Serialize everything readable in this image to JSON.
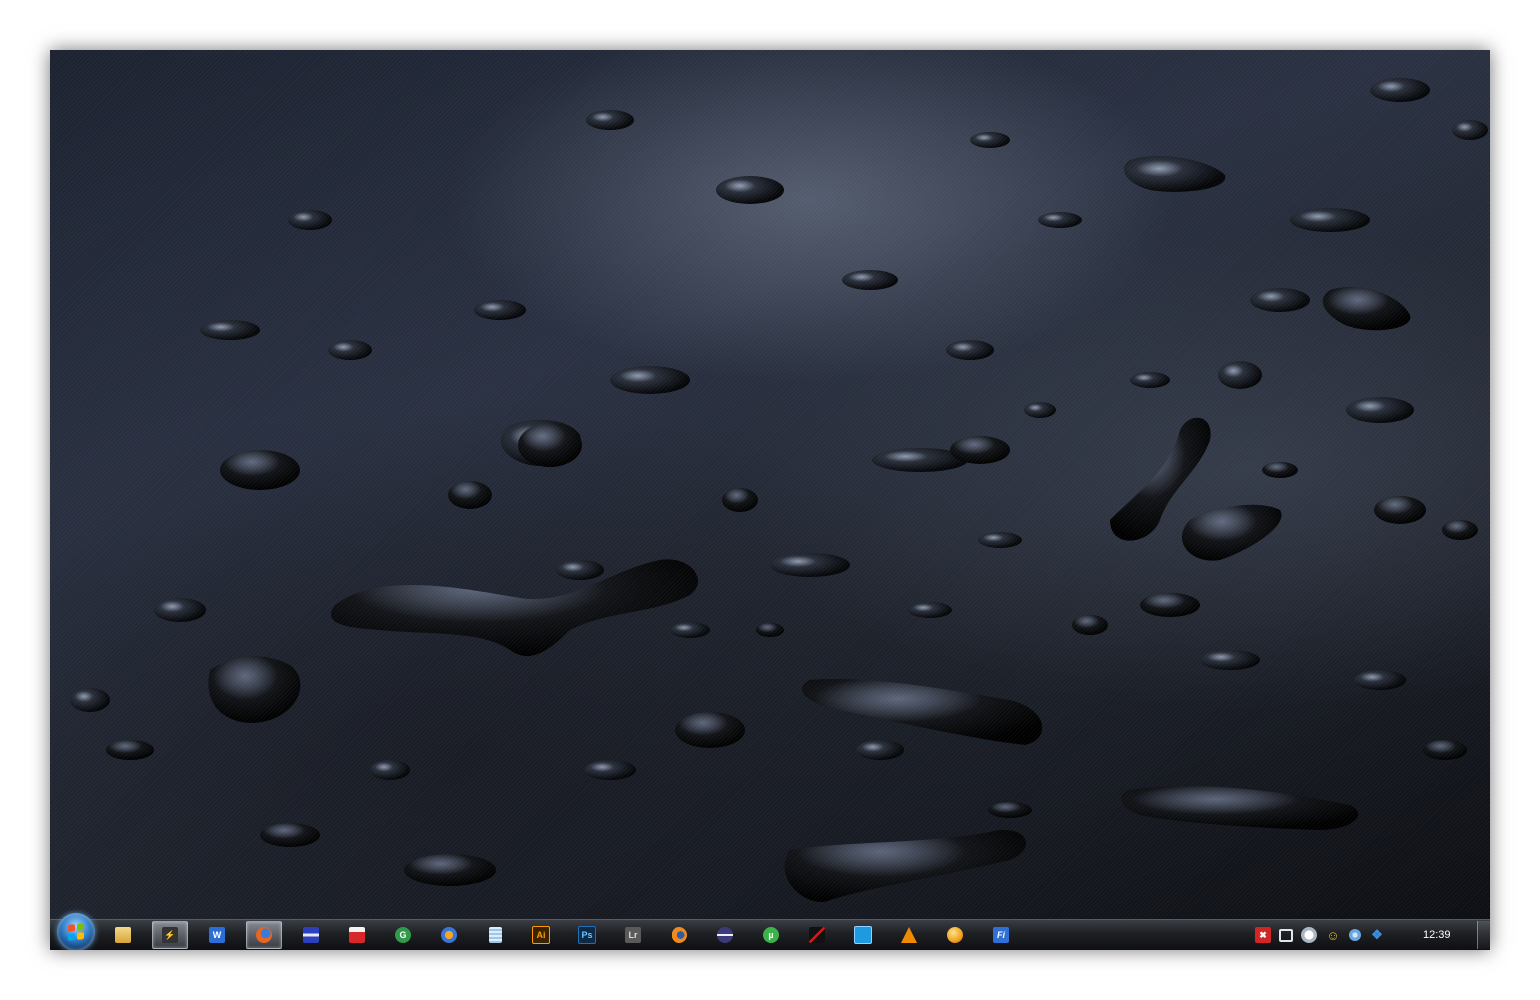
{
  "desktop": {
    "wallpaper": "water-droplets-dark"
  },
  "taskbar": {
    "start_button": {
      "icon": "windows-start-orb"
    },
    "pinned": [
      {
        "id": "explorer",
        "icon": "folder-icon",
        "label": "",
        "color": "#e8c25a",
        "active": false
      },
      {
        "id": "winamp",
        "icon": "winamp-icon",
        "label": "",
        "color": "#e8a020",
        "active": true
      },
      {
        "id": "word",
        "icon": "word-icon",
        "label": "W",
        "color": "#2b6fd6",
        "active": false
      },
      {
        "id": "firefox",
        "icon": "firefox-icon",
        "label": "",
        "color": "#e8651f",
        "active": true
      },
      {
        "id": "save",
        "icon": "floppy-disk-icon",
        "label": "",
        "color": "#2b3fbf",
        "active": false
      },
      {
        "id": "acrobat",
        "icon": "acrobat-icon",
        "label": "",
        "color": "#d8262b",
        "active": false
      },
      {
        "id": "app-g",
        "icon": "green-circle-app-icon",
        "label": "G",
        "color": "#2f9a4a",
        "active": false
      },
      {
        "id": "chrome-flame",
        "icon": "flame-browser-icon",
        "label": "",
        "color": "#3a76d6",
        "active": false
      },
      {
        "id": "notepad",
        "icon": "notepad-icon",
        "label": "",
        "color": "#9fc6e6",
        "active": false
      },
      {
        "id": "illustrator",
        "icon": "illustrator-icon",
        "label": "Ai",
        "color": "#ff9a00",
        "active": false
      },
      {
        "id": "photoshop",
        "icon": "photoshop-icon",
        "label": "Ps",
        "color": "#1f6fb5",
        "active": false
      },
      {
        "id": "lightroom",
        "icon": "lightroom-icon",
        "label": "Lr",
        "color": "#5a5a5a",
        "active": false
      },
      {
        "id": "blender",
        "icon": "blender-icon",
        "label": "",
        "color": "#f08a1e",
        "active": false
      },
      {
        "id": "eclipse",
        "icon": "eclipse-icon",
        "label": "",
        "color": "#3b3a7a",
        "active": false
      },
      {
        "id": "utorrent",
        "icon": "utorrent-icon",
        "label": "",
        "color": "#3bb34a",
        "active": false
      },
      {
        "id": "app-slash",
        "icon": "red-slash-app-icon",
        "label": "",
        "color": "#cc1d1d",
        "active": false
      },
      {
        "id": "app-blue",
        "icon": "blue-square-app-icon",
        "label": "",
        "color": "#1e9be0",
        "active": false
      },
      {
        "id": "vlc",
        "icon": "vlc-cone-icon",
        "label": "",
        "color": "#f08a00",
        "active": false
      },
      {
        "id": "app-orange",
        "icon": "orange-ball-icon",
        "label": "",
        "color": "#f0a020",
        "active": false
      },
      {
        "id": "app-fi",
        "icon": "fi-app-icon",
        "label": "Fi",
        "color": "#2f6fd6",
        "active": false
      }
    ]
  },
  "tray": {
    "icons": [
      {
        "id": "tray-red",
        "icon": "red-shield-icon",
        "color": "#d02626"
      },
      {
        "id": "tray-network",
        "icon": "network-icon",
        "color": "#dfe6ee"
      },
      {
        "id": "tray-clock",
        "icon": "clock-icon",
        "color": "#cfd8e2"
      },
      {
        "id": "tray-users",
        "icon": "users-icon",
        "color": "#e8b820"
      },
      {
        "id": "tray-blue-circle",
        "icon": "blue-circle-icon",
        "color": "#6aa7e0"
      },
      {
        "id": "tray-dropbox",
        "icon": "dropbox-icon",
        "color": "#3b8fe0"
      }
    ],
    "clock": "12:39"
  }
}
